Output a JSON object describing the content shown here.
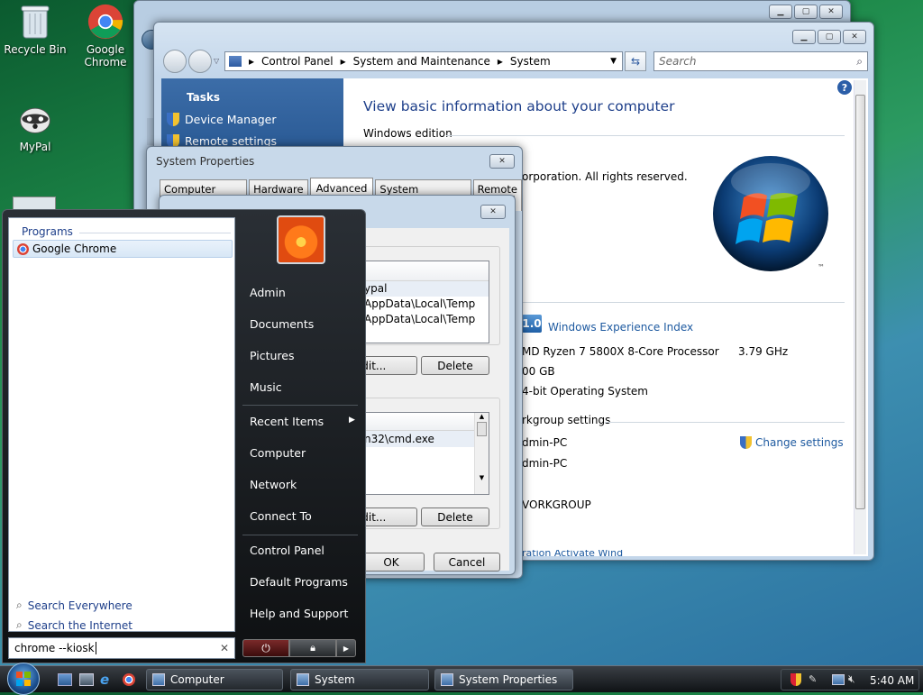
{
  "desktop": {
    "icons": [
      {
        "label": "Recycle Bin"
      },
      {
        "label": "Google Chrome"
      },
      {
        "label": "MyPal"
      }
    ]
  },
  "system_window": {
    "address": [
      "Control Panel",
      "System and Maintenance",
      "System"
    ],
    "search_placeholder": "Search",
    "tasks_title": "Tasks",
    "tasks": [
      "Device Manager",
      "Remote settings"
    ],
    "heading": "View basic information about your computer",
    "section_edition": "Windows edition",
    "copyright": "orporation.  All rights reserved.",
    "wei_score": "1.0",
    "wei_link": "Windows Experience Index",
    "processor": "MD Ryzen 7 5800X 8-Core Processor",
    "speed": "3.79 GHz",
    "memory": "00 GB",
    "system_type": "4-bit Operating System",
    "workgroup_section": "rkgroup settings",
    "computer_name": "dmin-PC",
    "full_name": "dmin-PC",
    "workgroup": "VORKGROUP",
    "change_settings": "Change settings",
    "activation": "ration Activate Wind"
  },
  "sysprops": {
    "title": "System Properties",
    "tabs": [
      "Computer Name",
      "Hardware",
      "Advanced",
      "System Protection",
      "Remote"
    ],
    "active_tab": "Advanced"
  },
  "env_dialog": {
    "user_vars": [
      "ypal",
      "AppData\\Local\\Temp",
      "AppData\\Local\\Temp"
    ],
    "sys_vars": [
      "n32\\cmd.exe"
    ],
    "edit_label": "Edit...",
    "delete_label": "Delete",
    "ok_label": "OK",
    "cancel_label": "Cancel"
  },
  "start_menu": {
    "programs_header": "Programs",
    "program_items": [
      "Google Chrome"
    ],
    "search_everywhere": "Search Everywhere",
    "search_internet": "Search the Internet",
    "search_value": "chrome --kiosk",
    "right_items": [
      "Admin",
      "Documents",
      "Pictures",
      "Music",
      "Recent Items",
      "Computer",
      "Network",
      "Connect To",
      "Control Panel",
      "Default Programs",
      "Help and Support"
    ]
  },
  "taskbar": {
    "buttons": [
      "Computer",
      "System",
      "System Properties"
    ],
    "clock": "5:40 AM"
  },
  "colors": {
    "accent_blue": "#1c5aa6",
    "link_blue": "#1e5aa0",
    "start_dark": "#1a1a1a"
  }
}
